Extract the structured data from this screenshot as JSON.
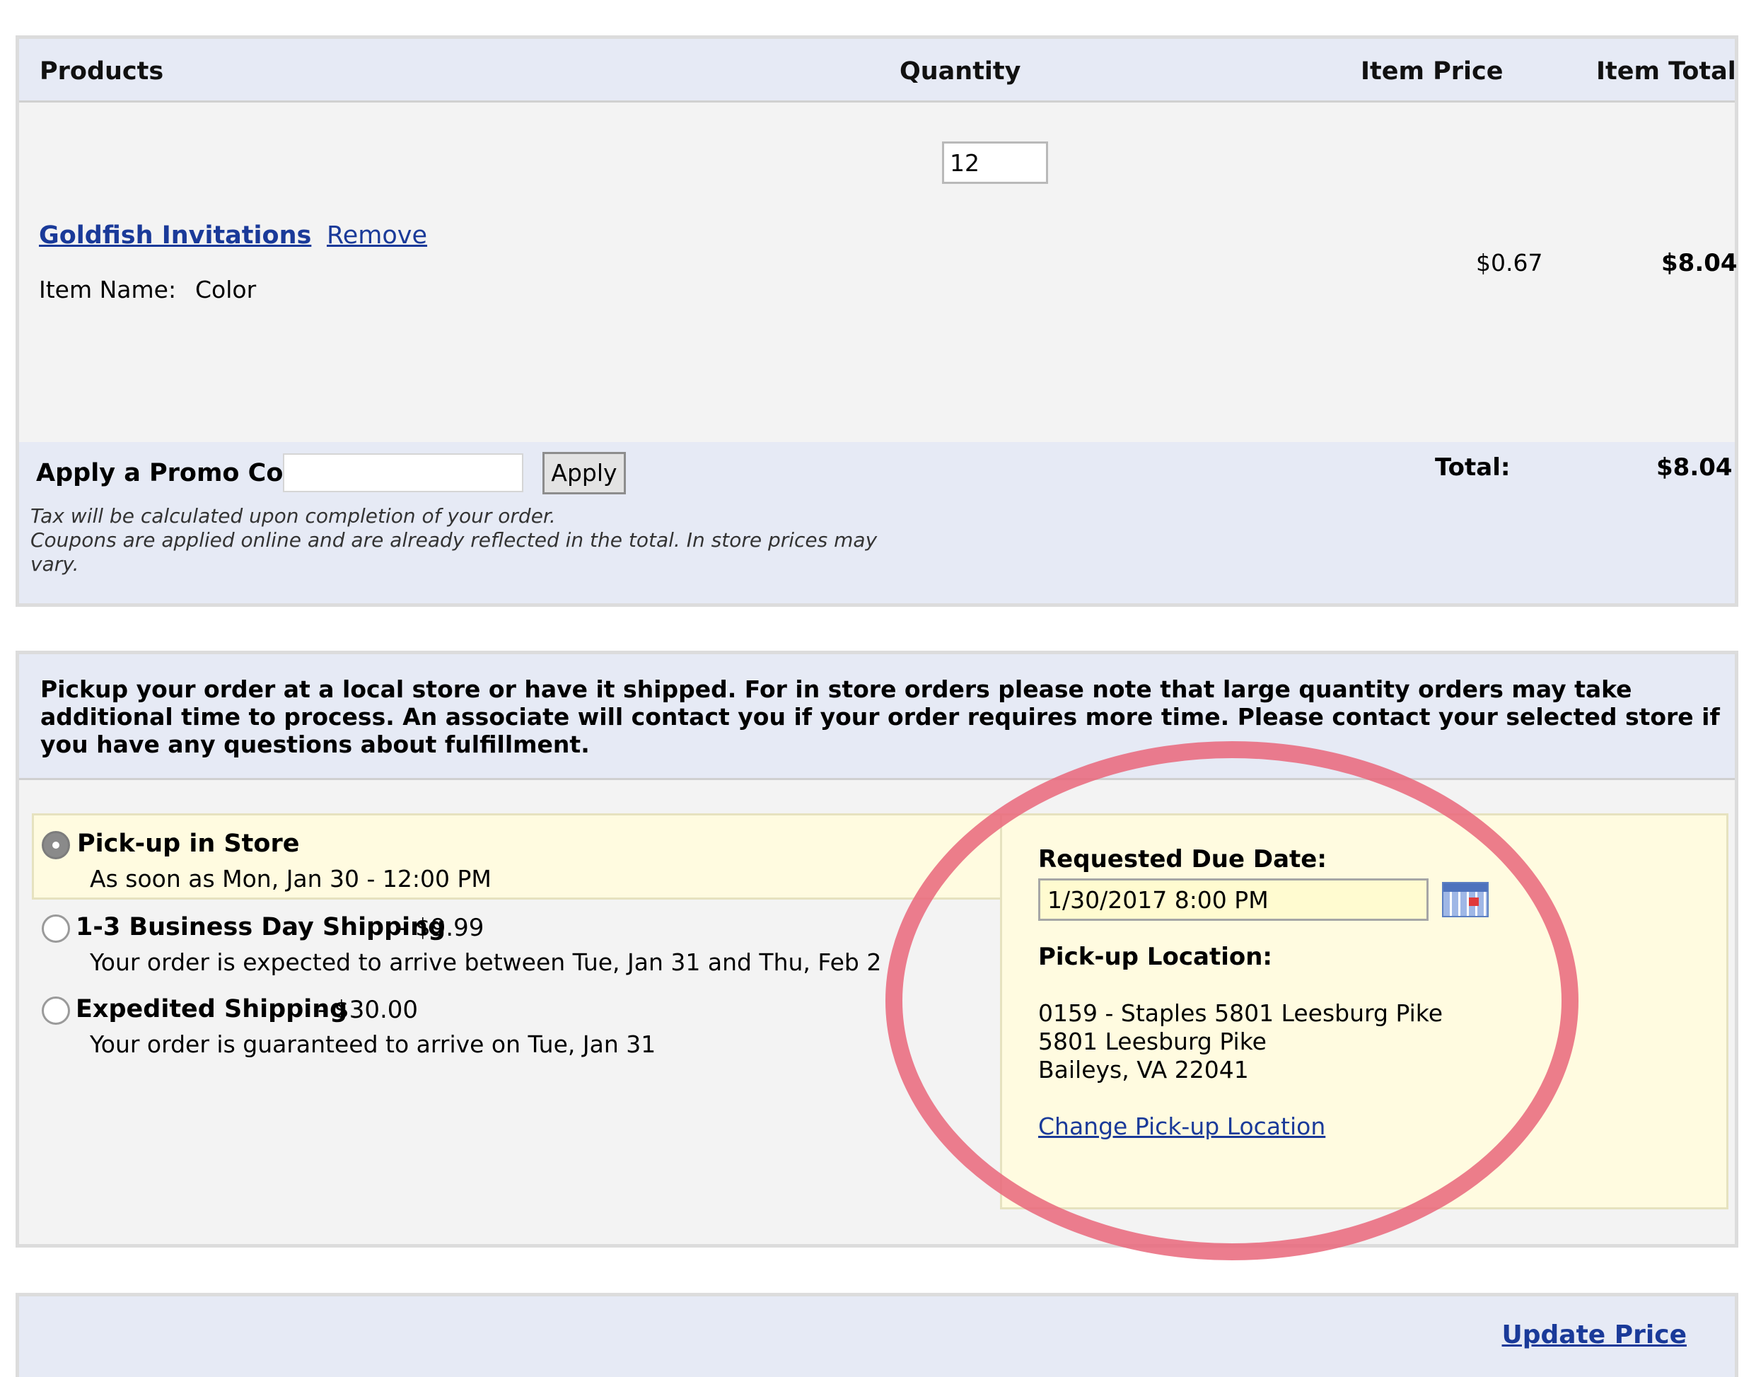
{
  "cart": {
    "headers": {
      "products": "Products",
      "quantity": "Quantity",
      "item_price": "Item Price",
      "item_total": "Item Total"
    },
    "item": {
      "quantity": "12",
      "product_name": "Goldfish Invitations",
      "remove_label": "Remove",
      "item_name_label": "Item Name:",
      "item_name_value": "Color",
      "item_price": "$0.67",
      "item_total": "$8.04"
    },
    "promo": {
      "label": "Apply a Promo Code",
      "value": "",
      "button": "Apply"
    },
    "total_label": "Total:",
    "total_value": "$8.04",
    "notes": [
      "Tax will be calculated upon completion of your order.",
      "Coupons are applied online and are already reflected in the total. In store prices may vary."
    ]
  },
  "fulfillment": {
    "message": "Pickup your order at a local store or have it shipped. For in store orders please note that large quantity orders may take additional time to process. An associate will contact you if your order requires more time. Please contact your selected store if you have any questions about fulfillment.",
    "options": [
      {
        "title": "Pick-up in Store",
        "price": "",
        "detail": "As soon as Mon, Jan 30 - 12:00 PM",
        "selected": true
      },
      {
        "title": "1-3 Business Day Shipping",
        "price": "- $9.99",
        "detail": "Your order is expected to arrive between Tue, Jan 31 and Thu, Feb 2",
        "selected": false
      },
      {
        "title": "Expedited Shipping",
        "price": "- $30.00",
        "detail": "Your order is guaranteed to arrive on Tue, Jan 31",
        "selected": false
      }
    ],
    "pickup": {
      "due_date_label": "Requested Due Date:",
      "due_date_value": "1/30/2017 8:00 PM",
      "location_label": "Pick-up Location:",
      "address_lines": [
        "0159 - Staples 5801 Leesburg Pike",
        "5801 Leesburg Pike",
        "Baileys, VA 22041"
      ],
      "change_link": "Change Pick-up Location"
    }
  },
  "footer": {
    "update_price": "Update Price"
  },
  "icons": {
    "calendar": "calendar-icon",
    "radio": "radio-button"
  },
  "colors": {
    "link": "#1a3a99",
    "header_bg": "#e6eaf5",
    "panel_bg": "#f3f3f3",
    "highlight_bg": "#fffbe0",
    "annotation": "#e9667a"
  }
}
